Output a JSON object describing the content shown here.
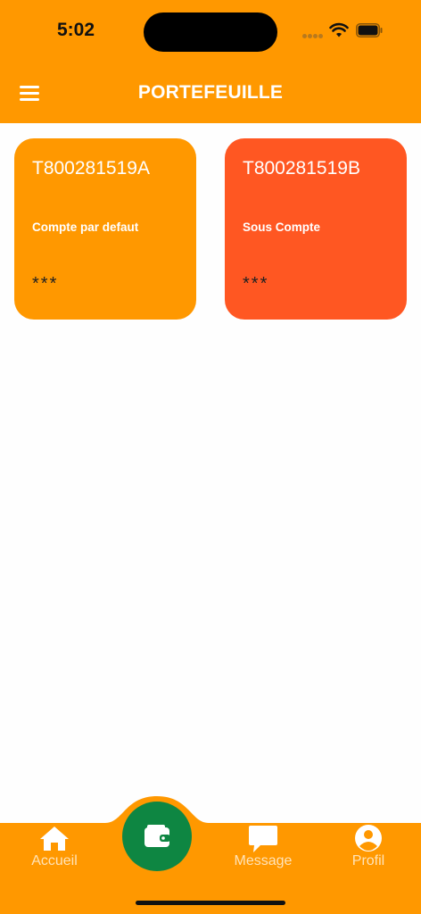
{
  "status_bar": {
    "time": "5:02"
  },
  "header": {
    "title": "PORTEFEUILLE"
  },
  "accounts": [
    {
      "number": "T800281519A",
      "type": "Compte par defaut",
      "balance": "***",
      "color": "#ff9800"
    },
    {
      "number": "T800281519B",
      "type": "Sous Compte",
      "balance": "***",
      "color": "#ff5722"
    }
  ],
  "bottom_nav": {
    "items": [
      {
        "label": "Accueil",
        "icon": "home-icon"
      },
      {
        "label": "Message",
        "icon": "chat-icon"
      },
      {
        "label": "Profil",
        "icon": "profile-icon"
      }
    ],
    "center": {
      "icon": "wallet-icon"
    }
  },
  "colors": {
    "primary": "#ff9800",
    "secondary": "#ff5722",
    "fab": "#0e8642"
  }
}
